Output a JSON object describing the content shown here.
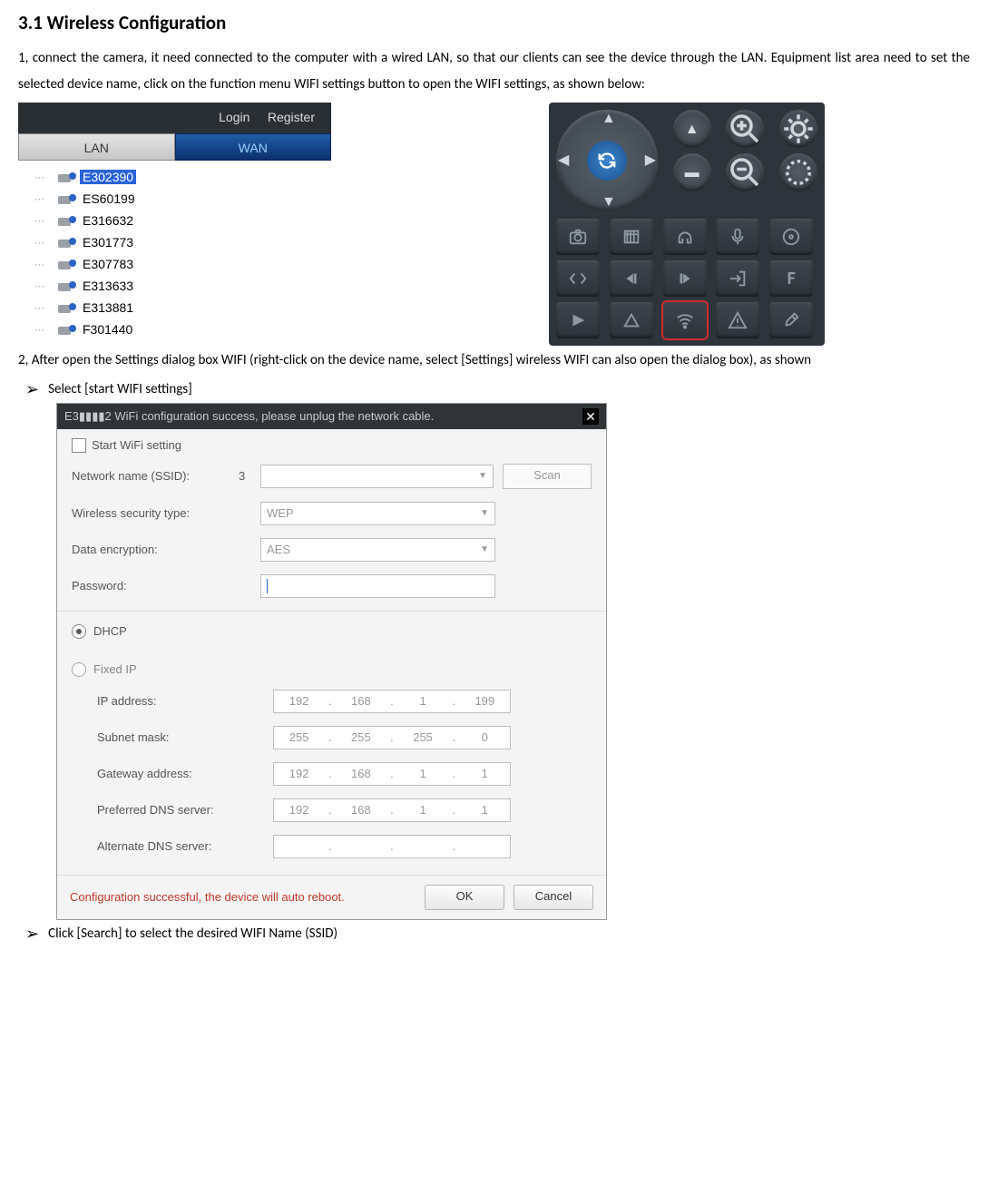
{
  "heading": "3.1 Wireless Configuration",
  "para1": "1, connect the camera, it need connected to the computer with a wired LAN, so that our clients can see the device through the LAN. Equipment list area need to set the selected device name, click on the function menu WIFI settings button to open the WIFI settings, as shown below:",
  "fig1": {
    "login": "Login",
    "register": "Register",
    "lan": "LAN",
    "wan": "WAN",
    "devices": [
      "E302390",
      "ES60199",
      "E316632",
      "E301773",
      "E307783",
      "E313633",
      "E313881",
      "F301440"
    ]
  },
  "para2": "2, After open the Settings dialog box WIFI (right-click on the device name, select [Settings] wireless WIFI can also open the dialog box), as shown",
  "bullet1": "Select [start WIFI settings]",
  "bullet2": "Click [Search] to select the desired WIFI Name (SSID)",
  "dialog": {
    "title": "E3▮▮▮▮2  WiFi configuration success, please unplug the network cable.",
    "start_label": "Start WiFi setting",
    "ssid_label": "Network name (SSID):",
    "ssid_count": "3",
    "scan": "Scan",
    "sec_label": "Wireless security type:",
    "sec_value": "WEP",
    "enc_label": "Data encryption:",
    "enc_value": "AES",
    "pw_label": "Password:",
    "dhcp": "DHCP",
    "fixed": "Fixed IP",
    "ip_label": "IP address:",
    "ip": [
      "192",
      "168",
      "1",
      "199"
    ],
    "mask_label": "Subnet mask:",
    "mask": [
      "255",
      "255",
      "255",
      "0"
    ],
    "gw_label": "Gateway address:",
    "gw": [
      "192",
      "168",
      "1",
      "1"
    ],
    "dns1_label": "Preferred DNS server:",
    "dns1": [
      "192",
      "168",
      "1",
      "1"
    ],
    "dns2_label": "Alternate DNS server:",
    "dns2": [
      "",
      "",
      "",
      ""
    ],
    "foot_msg": "Configuration successful, the device will auto reboot.",
    "ok": "OK",
    "cancel": "Cancel"
  }
}
